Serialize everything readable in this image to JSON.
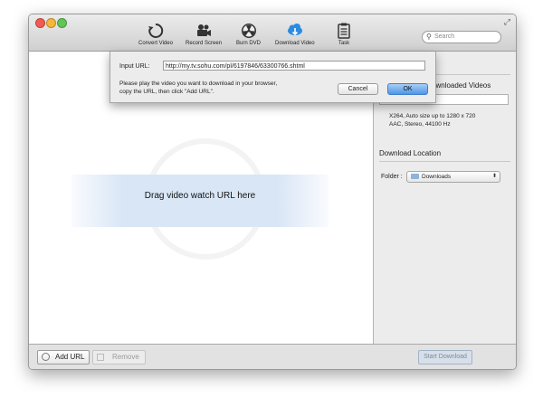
{
  "toolbar": {
    "items": [
      {
        "label": "Convert Video",
        "icon": "refresh-icon"
      },
      {
        "label": "Record Screen",
        "icon": "video-camera-icon"
      },
      {
        "label": "Burn DVD",
        "icon": "radiation-icon"
      },
      {
        "label": "Download Video",
        "icon": "cloud-download-icon"
      },
      {
        "label": "Task",
        "icon": "clipboard-icon"
      }
    ],
    "active_color": "#2a8be0"
  },
  "search": {
    "placeholder": "Search"
  },
  "url_sheet": {
    "input_label": "Input URL:",
    "input_value": "http://my.tv.sohu.com/pl/6197846/63300766.shtml",
    "instructions": "Please play the video you want to download in your browser, copy the URL, then click \"Add URL\".",
    "cancel_label": "Cancel",
    "ok_label": "OK"
  },
  "main": {
    "drop_text": "Drag video watch URL here"
  },
  "side": {
    "downloaded_title": "ownloaded Videos",
    "format_line1": "X264, Auto size up to 1280 x 720",
    "format_line2": "AAC, Stereo, 44100 Hz",
    "location_title": "Download Location",
    "folder_label": "Folder :",
    "folder_value": "Downloads"
  },
  "bottom": {
    "add_url_label": "Add URL",
    "remove_label": "Remove",
    "start_download_label": "Start Download"
  }
}
